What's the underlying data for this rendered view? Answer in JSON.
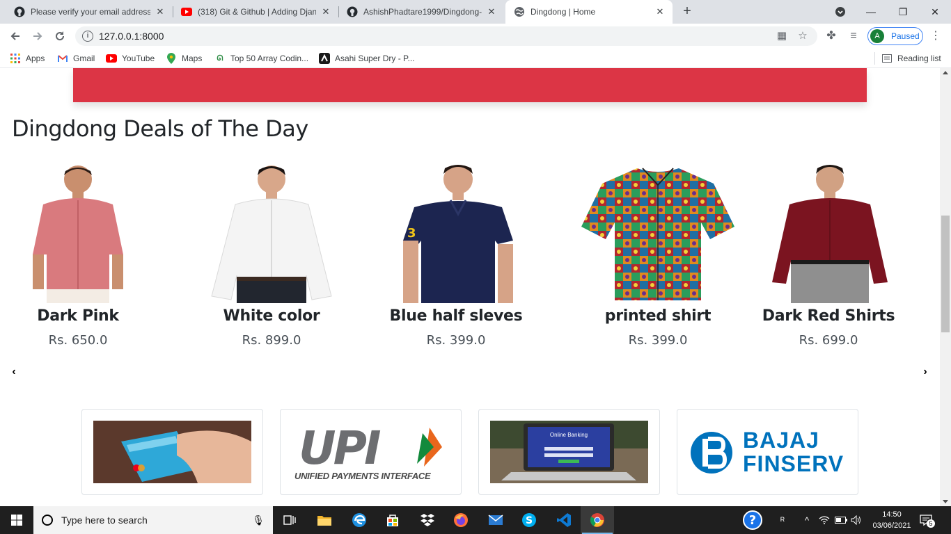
{
  "browser": {
    "tabs": [
      {
        "title": "Please verify your email address",
        "icon": "github-icon",
        "active": false
      },
      {
        "title": "(318) Git & Github | Adding Djan",
        "icon": "youtube-icon",
        "active": false
      },
      {
        "title": "AshishPhadtare1999/Dingdong-",
        "icon": "github-icon",
        "active": false
      },
      {
        "title": "Dingdong | Home",
        "icon": "globe-icon",
        "active": true
      }
    ],
    "url": "127.0.0.1:8000",
    "profile_initial": "A",
    "profile_status": "Paused",
    "reading_list": "Reading list",
    "bookmarks": [
      {
        "label": "Apps",
        "icon": "apps-grid-icon"
      },
      {
        "label": "Gmail",
        "icon": "gmail-icon"
      },
      {
        "label": "YouTube",
        "icon": "youtube-icon"
      },
      {
        "label": "Maps",
        "icon": "maps-icon"
      },
      {
        "label": "Top 50 Array Codin...",
        "icon": "geeksforgeeks-icon"
      },
      {
        "label": "Asahi Super Dry - P...",
        "icon": "asahi-icon"
      }
    ]
  },
  "page": {
    "deals_title": "Dingdong Deals of The Day",
    "products": [
      {
        "name": "Dark Pink",
        "price": "Rs. 650.0",
        "color": "#d97a7e"
      },
      {
        "name": "White color",
        "price": "Rs. 899.0",
        "color": "#f2f2f2"
      },
      {
        "name": "Blue half sleves",
        "price": "Rs. 399.0",
        "color": "#1c2550"
      },
      {
        "name": "printed shirt",
        "price": "Rs. 399.0",
        "color": "#b3262e"
      },
      {
        "name": "Dark Red Shirts",
        "price": "Rs. 699.0",
        "color": "#7b1420"
      }
    ],
    "payments": [
      {
        "name": "card-payment",
        "caption": ""
      },
      {
        "name": "upi",
        "logo_text": "UPI",
        "caption": "UNIFIED PAYMENTS INTERFACE"
      },
      {
        "name": "online-banking",
        "screen_text": "Online Banking"
      },
      {
        "name": "bajaj-finserv",
        "line1": "BAJAJ",
        "line2": "FINSERV"
      }
    ],
    "banner_color": "#dc3545"
  },
  "taskbar": {
    "search_placeholder": "Type here to search",
    "time": "14:50",
    "date": "03/06/2021",
    "notifications": "5"
  }
}
